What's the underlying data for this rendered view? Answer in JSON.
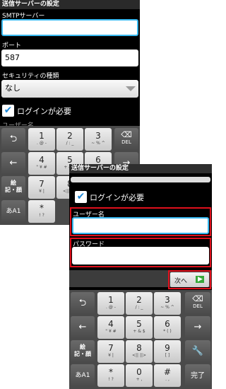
{
  "screen1": {
    "title": "送信サーバーの設定",
    "smtp_label": "SMTPサーバー",
    "smtp_value": "",
    "port_label": "ポート",
    "port_value": "587",
    "security_label": "セキュリティの種類",
    "security_value": "なし",
    "login_required_label": "ログインが必要",
    "username_label_partial": "ユーザー名"
  },
  "screen2": {
    "title": "送信サーバーの設定",
    "login_required_label": "ログインが必要",
    "username_label": "ユーザー名",
    "username_value": "",
    "password_label": "パスワード",
    "password_value": "",
    "next_label": "次へ"
  },
  "keyboard": {
    "back_label": "⮌",
    "left_label": "←",
    "emoji_label": "絵\n記・顔",
    "mode_label": "あA1",
    "del_label": "DEL",
    "done_label": "完了",
    "keys": [
      {
        "main": "1",
        "sub": ". @ -"
      },
      {
        "main": "2",
        "sub": "/ : _"
      },
      {
        "main": "3",
        "sub": "~ % ^"
      },
      {
        "main": "4",
        "sub": "\" ¥ #"
      },
      {
        "main": "5",
        "sub": "+ & $"
      },
      {
        "main": "6",
        "sub": "* ( )"
      },
      {
        "main": "7",
        "sub": "¥ |"
      },
      {
        "main": "8",
        "sub": "<|| ||>"
      },
      {
        "main": "9",
        "sub": "[ ]"
      },
      {
        "main": "*",
        "sub": "! ?"
      },
      {
        "main": "0",
        "sub": "+ ,"
      },
      {
        "main": "#",
        "sub": ". ,"
      }
    ]
  },
  "colors": {
    "focus_border": "#39b9f0",
    "annotation_red": "#e0101c",
    "check_blue": "#1e88d8",
    "next_green": "#37a93a"
  }
}
